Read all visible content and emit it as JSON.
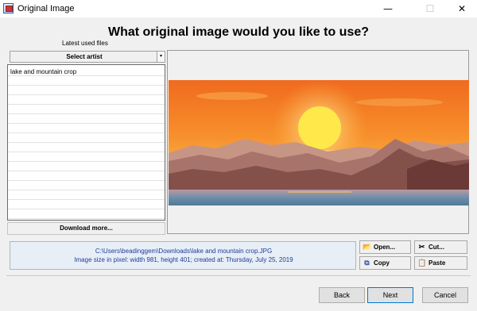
{
  "window": {
    "title": "Original Image",
    "minimize": "—",
    "maximize": "☐",
    "close": "✕"
  },
  "heading": "What original image would you like to use?",
  "latest_used_label": "Latest used files",
  "select_artist": {
    "label": "Select artist",
    "arrow": "▾"
  },
  "file_list": {
    "items": [
      "lake and mountain crop"
    ]
  },
  "download_more": "Download more...",
  "preview": {
    "image_name": "lake and mountain crop"
  },
  "info": {
    "path": "C:\\Users\\beadinggem\\Downloads\\lake and mountain crop.JPG",
    "details": "Image size in pixel: width 981, height 401; created at: Thursday, July 25, 2019"
  },
  "tools": {
    "open": "Open...",
    "cut": "Cut...",
    "copy": "Copy",
    "paste": "Paste"
  },
  "nav": {
    "back": "Back",
    "next": "Next",
    "cancel": "Cancel"
  },
  "colors": {
    "sky_top": "#f47a22",
    "sky_glow": "#fbb64a",
    "sun": "#ffe94a",
    "water": "#5e86a6",
    "mountain_far": "#b28678",
    "mountain_near": "#7a4a44",
    "accent": "#0078d7"
  }
}
